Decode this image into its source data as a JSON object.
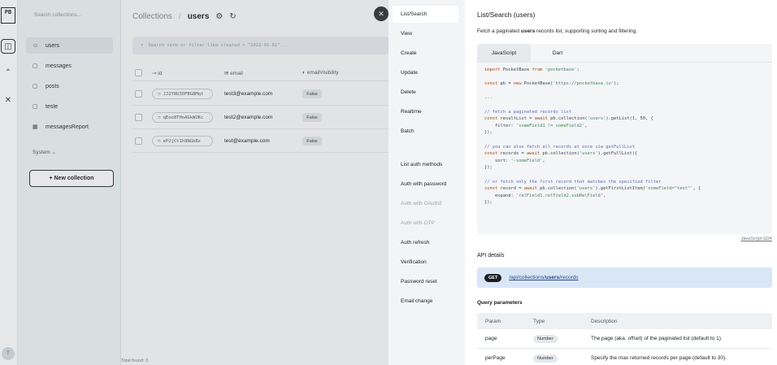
{
  "rail": {
    "logo": "PB",
    "avatar": "T"
  },
  "collections": {
    "search_placeholder": "Search collections...",
    "items": [
      {
        "label": "users",
        "icon": "users-icon",
        "active": true
      },
      {
        "label": "messages",
        "icon": "folder-icon"
      },
      {
        "label": "posts",
        "icon": "folder-icon"
      },
      {
        "label": "teste",
        "icon": "folder-icon"
      },
      {
        "label": "messagesReport",
        "icon": "table-icon"
      }
    ],
    "system_label": "System",
    "new_collection": "+ New collection"
  },
  "main": {
    "breadcrumb_root": "Collections",
    "breadcrumb_current": "users",
    "filter_placeholder": "Search term or filter like created > \"2022-01-01\"...",
    "columns": [
      "id",
      "email",
      "emailVisibility"
    ],
    "rows": [
      {
        "id": "JJ2YRU3OFBG8Mqt",
        "email": "test3@example.com",
        "emailVisibility": "False"
      },
      {
        "id": "qEoo8THoAGkWUKc",
        "email": "test2@example.com",
        "emailVisibility": "False"
      },
      {
        "id": "eP2jCt1h9NGbBz",
        "email": "test@example.com",
        "emailVisibility": "False"
      }
    ],
    "total_found": "Total found: 3"
  },
  "docs_nav": {
    "items": [
      {
        "label": "List/Search",
        "active": true
      },
      {
        "label": "View"
      },
      {
        "label": "Create"
      },
      {
        "label": "Update"
      },
      {
        "label": "Delete"
      },
      {
        "label": "Realtime"
      },
      {
        "label": "Batch"
      },
      {
        "label": "List auth methods"
      },
      {
        "label": "Auth with password"
      },
      {
        "label": "Auth with OAuth2",
        "disabled": true
      },
      {
        "label": "Auth with OTP",
        "disabled": true
      },
      {
        "label": "Auth refresh"
      },
      {
        "label": "Verification"
      },
      {
        "label": "Password reset"
      },
      {
        "label": "Email change"
      }
    ]
  },
  "docs": {
    "title": "List/Search (users)",
    "desc_pre": "Fetch a paginated ",
    "desc_bold": "users",
    "desc_post": " records list, supporting sorting and filtering.",
    "tabs": [
      "JavaScript",
      "Dart"
    ],
    "code_lines": [
      "import PocketBase from 'pocketbase';",
      "",
      "const pb = new PocketBase('https://pocketbase.io');",
      "",
      "...",
      "",
      "// fetch a paginated records list",
      "const resultList = await pb.collection('users').getList(1, 50, {",
      "    filter: 'someField1 != someField2',",
      "});",
      "",
      "// you can also fetch all records at once via getFullList",
      "const records = await pb.collection('users').getFullList({",
      "    sort: '-someField',",
      "});",
      "",
      "// or fetch only the first record that matches the specified filter",
      "const record = await pb.collection('users').getFirstListItem('someField=\"test\"', {",
      "    expand: 'relField1,relField2.subRelField',",
      "});"
    ],
    "sdk_link": "JavaScript SDK",
    "api_details": "API details",
    "method": "GET",
    "path_pre": "/api/collections/",
    "path_bold": "users",
    "path_post": "/records",
    "query_params": "Query parameters",
    "param_headers": [
      "Param",
      "Type",
      "Description"
    ],
    "params": [
      {
        "name": "page",
        "type": "Number",
        "desc": "The page (aka. offset) of the paginated list (default to 1)."
      },
      {
        "name": "perPage",
        "type": "Number",
        "desc": "Specify the max returned records per page (default to 30)."
      }
    ]
  }
}
